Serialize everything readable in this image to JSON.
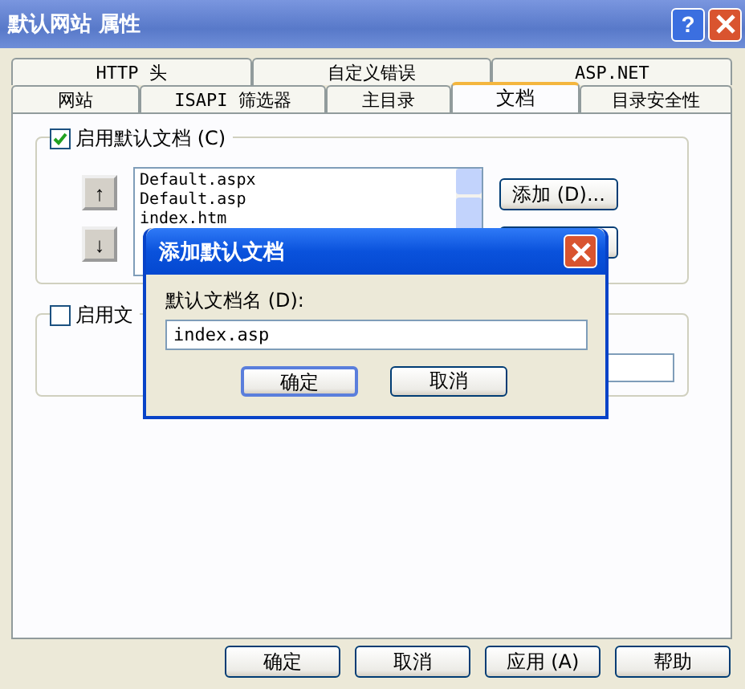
{
  "window": {
    "title": "默认网站 属性",
    "help_button": "?"
  },
  "tabs_back": [
    {
      "label": "HTTP 头",
      "selected": false
    },
    {
      "label": "自定义错误",
      "selected": false
    },
    {
      "label": "ASP.NET",
      "selected": false
    }
  ],
  "tabs_front": [
    {
      "label": "网站",
      "selected": false
    },
    {
      "label": "ISAPI 筛选器",
      "selected": false
    },
    {
      "label": "主目录",
      "selected": false
    },
    {
      "label": "文档",
      "selected": true
    },
    {
      "label": "目录安全性",
      "selected": false
    }
  ],
  "default_docs": {
    "label": "启用默认文档 (C)",
    "checked": true,
    "up_button": "↑",
    "down_button": "↓",
    "items": [
      "Default.aspx",
      "Default.asp",
      "index.htm"
    ],
    "add_button": "添加 (D)..."
  },
  "footer_group": {
    "label": "启用文",
    "checked": false
  },
  "dialog": {
    "title": "添加默认文档",
    "field_label": "默认文档名 (D):",
    "value": "index.asp",
    "buttons": [
      "确定",
      "取消"
    ]
  },
  "buttons": [
    "确定",
    "取消",
    "应用 (A)",
    "帮助"
  ]
}
